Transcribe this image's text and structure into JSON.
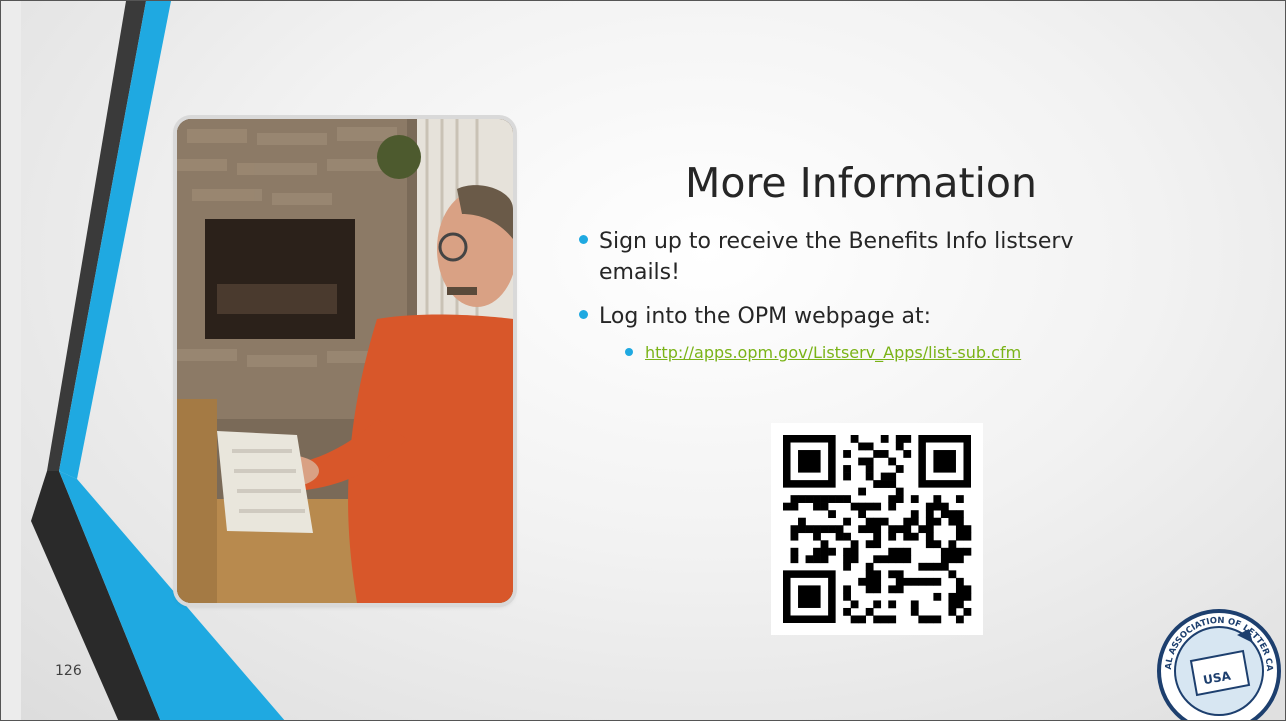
{
  "slide": {
    "title": "More Information",
    "bullets": [
      {
        "text": "Sign up to receive the Benefits Info listserv emails!"
      },
      {
        "text": "Log into the OPM webpage at:"
      }
    ],
    "sub_link": "http://apps.opm.gov/Listserv_Apps/list-sub.cfm",
    "page_number": "126",
    "photo_icon": "man-typing-at-computer-photo",
    "qr_icon": "qr-code-icon",
    "logo": {
      "icon": "nalc-seal-icon",
      "text_top": "NATIONAL ASSOCIATION OF LETTER CARRIERS",
      "text_center": "USA"
    },
    "colors": {
      "accent_blue": "#1fa9e1",
      "link_green": "#7ab317",
      "dark_gray": "#404040",
      "logo_navy": "#1d3f6e"
    }
  }
}
